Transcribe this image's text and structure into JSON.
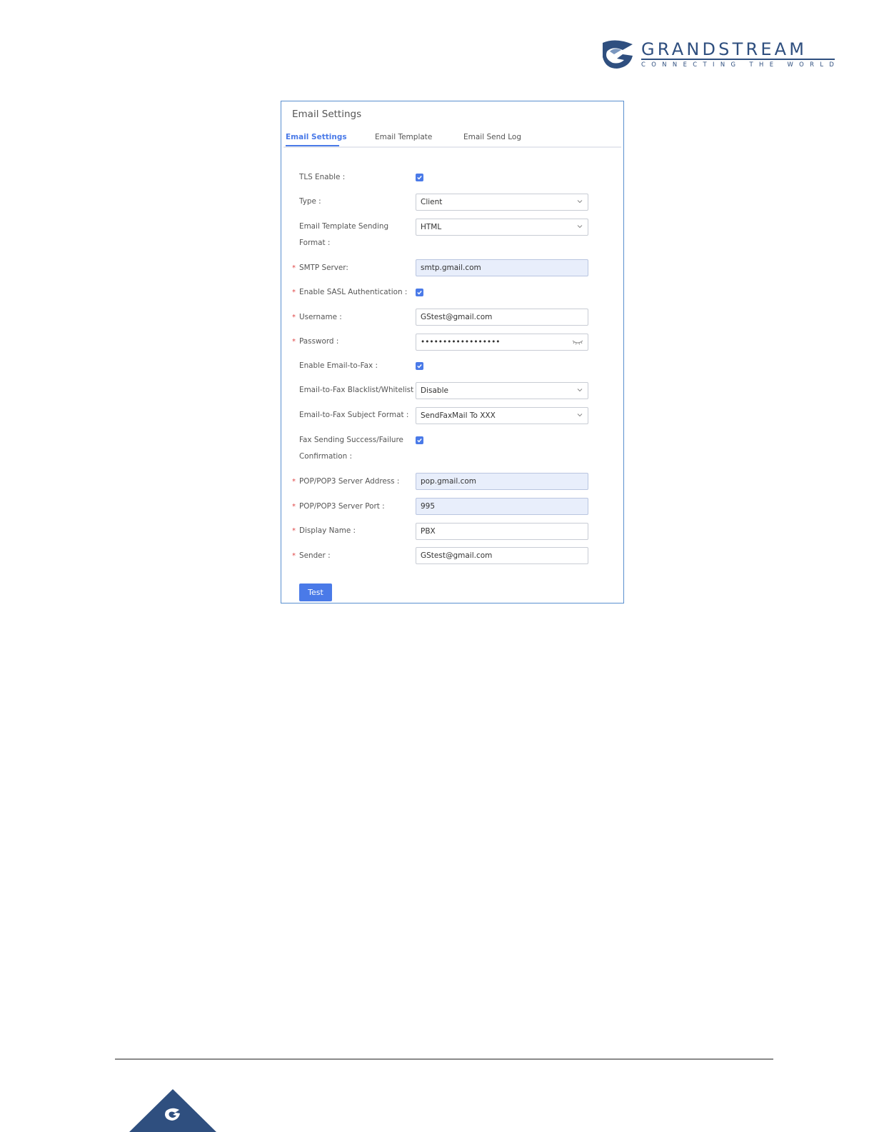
{
  "brand": {
    "name": "GRANDSTREAM",
    "tagline": "CONNECTING THE WORLD",
    "color": "#2f4f7f"
  },
  "panel": {
    "title": "Email Settings",
    "tabs": [
      {
        "label": "Email Settings",
        "active": true
      },
      {
        "label": "Email Template",
        "active": false
      },
      {
        "label": "Email Send Log",
        "active": false
      }
    ],
    "accent_color": "#4a7ae8"
  },
  "form": {
    "tls_enable": {
      "label": "TLS Enable :",
      "checked": true
    },
    "type": {
      "label": "Type :",
      "value": "Client"
    },
    "template_format": {
      "label_line1": "Email Template Sending",
      "label_line2": "Format :",
      "value": "HTML"
    },
    "smtp_server": {
      "label": "SMTP Server:",
      "value": "smtp.gmail.com",
      "required": true
    },
    "sasl_auth": {
      "label": "Enable SASL Authentication :",
      "checked": true,
      "required": true
    },
    "username": {
      "label": "Username :",
      "value": "GStest@gmail.com",
      "required": true
    },
    "password": {
      "label": "Password :",
      "value": "••••••••••••••••••",
      "required": true
    },
    "email_to_fax": {
      "label": "Enable Email-to-Fax :",
      "checked": true
    },
    "blacklist_whitelist": {
      "label": "Email-to-Fax Blacklist/Whitelist :",
      "value": "Disable"
    },
    "subject_format": {
      "label": "Email-to-Fax Subject Format :",
      "value": "SendFaxMail To XXX"
    },
    "fax_confirmation": {
      "label_line1": "Fax Sending Success/Failure",
      "label_line2": "Confirmation :",
      "checked": true
    },
    "pop_address": {
      "label": "POP/POP3 Server Address :",
      "value": "pop.gmail.com",
      "required": true
    },
    "pop_port": {
      "label": "POP/POP3 Server Port :",
      "value": "995",
      "required": true
    },
    "display_name": {
      "label": "Display Name :",
      "value": "PBX",
      "required": true
    },
    "sender": {
      "label": "Sender :",
      "value": "GStest@gmail.com",
      "required": true
    },
    "required_marker": "*",
    "test_button": "Test"
  },
  "icons": [
    "grandstream-logo-icon",
    "checkbox-checked-icon",
    "chevron-down-icon",
    "eye-hidden-icon"
  ]
}
